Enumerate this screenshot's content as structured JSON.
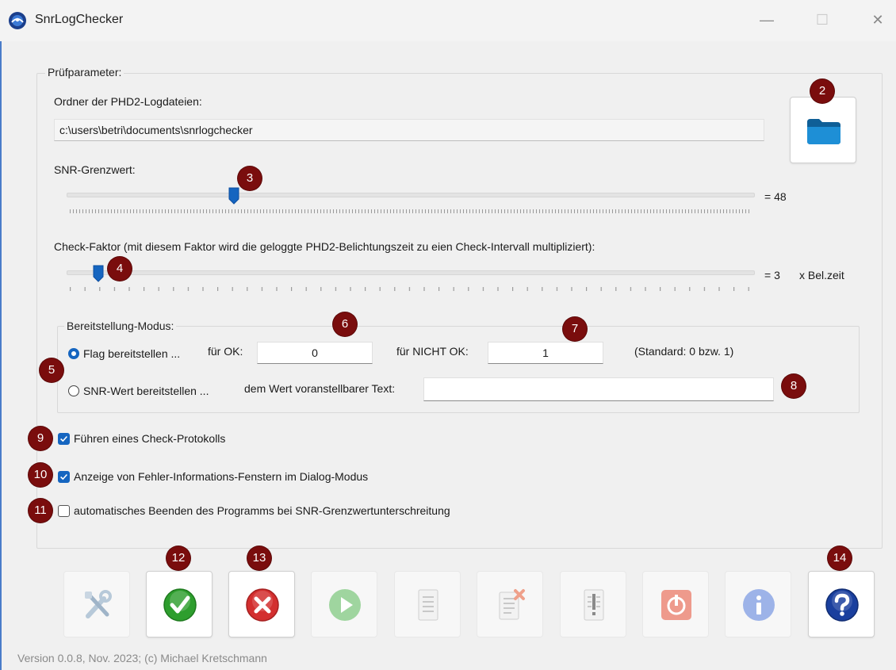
{
  "window": {
    "title": "SnrLogChecker",
    "minimize": "—",
    "maximize": "☐",
    "close": "✕"
  },
  "group_params": {
    "title": "Prüfparameter:",
    "folder_label": "Ordner der PHD2-Logdateien:",
    "folder_value": "c:\\users\\betri\\documents\\snrlogchecker",
    "snr_label": "SNR-Grenzwert:",
    "snr_readout": "= 48",
    "snr_value": 48,
    "check_label": "Check-Faktor (mit diesem Faktor wird die geloggte PHD2-Belichtungszeit zu eien Check-Intervall multipliziert):",
    "check_readout": "= 3",
    "check_unit": "x Bel.zeit",
    "check_value": 3
  },
  "group_mode": {
    "title": "Bereitstellung-Modus:",
    "radio_flag": "Flag bereitstellen ...",
    "radio_snr": "SNR-Wert bereitstellen ...",
    "ok_label": "für OK:",
    "ok_value": "0",
    "notok_label": "für NICHT OK:",
    "notok_value": "1",
    "standard_hint": "(Standard: 0 bzw. 1)",
    "prefix_label": "dem Wert voranstellbarer Text:",
    "prefix_value": ""
  },
  "options": {
    "protocol": "Führen eines Check-Protokolls",
    "error_windows": "Anzeige von Fehler-Informations-Fenstern im Dialog-Modus",
    "auto_exit": "automatisches Beenden des Programms bei SNR-Grenzwertunterschreitung"
  },
  "badges": {
    "b2": "2",
    "b3": "3",
    "b4": "4",
    "b5": "5",
    "b6": "6",
    "b7": "7",
    "b8": "8",
    "b9": "9",
    "b10": "10",
    "b11": "11",
    "b12": "12",
    "b13": "13",
    "b14": "14"
  },
  "icons": {
    "settings": "tools-icon",
    "ok": "checkmark-icon",
    "cancel": "x-icon",
    "start": "play-icon",
    "log": "document-icon",
    "delete_log": "delete-document-icon",
    "warning_log": "exclamation-document-icon",
    "stop": "power-icon",
    "info": "info-icon",
    "help": "help-icon",
    "folder": "folder-icon"
  },
  "colors": {
    "accent": "#1565c0",
    "badge": "#7a0d0d",
    "ok_green": "#2e9e2e",
    "cancel_red": "#d32f2f",
    "help_blue": "#1a3f9e"
  },
  "footer": {
    "version": "Version 0.0.8, Nov. 2023; (c) Michael Kretschmann"
  }
}
